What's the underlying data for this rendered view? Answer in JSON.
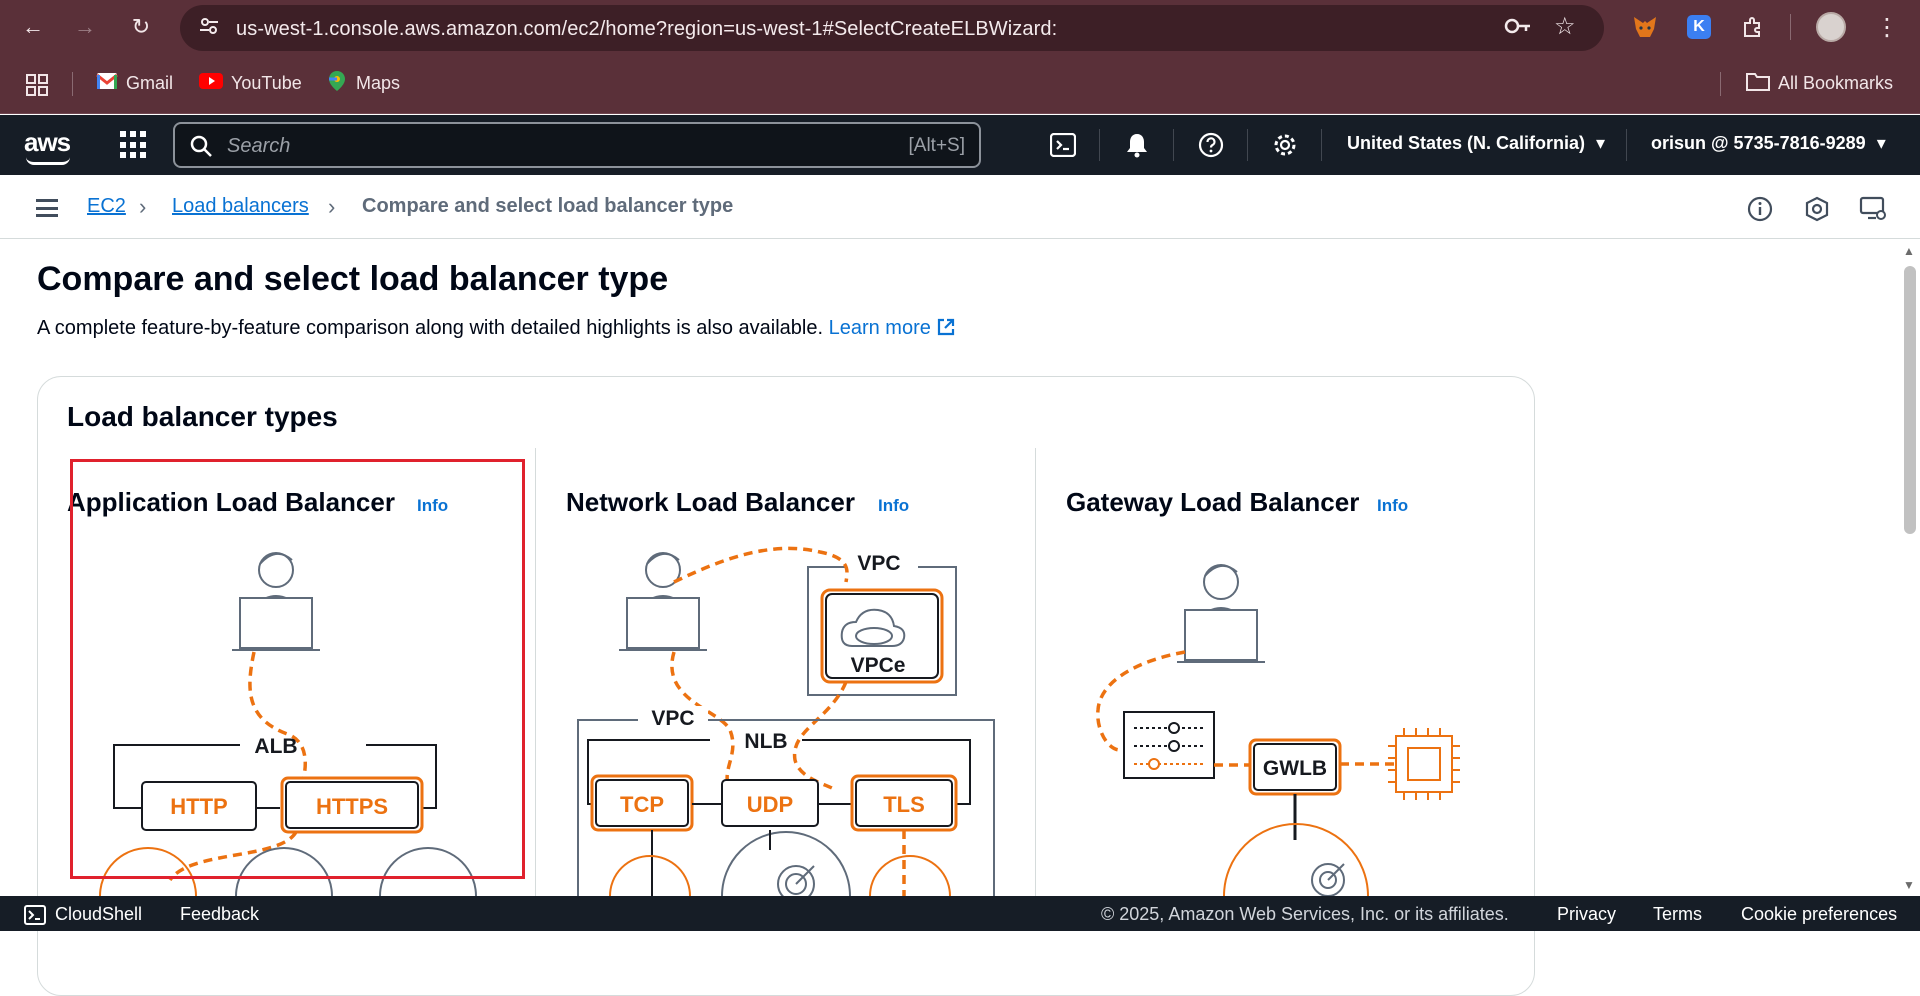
{
  "browser": {
    "url": "us-west-1.console.aws.amazon.com/ec2/home?region=us-west-1#SelectCreateELBWizard:",
    "bookmarks": [
      {
        "label": "Gmail"
      },
      {
        "label": "YouTube"
      },
      {
        "label": "Maps"
      }
    ],
    "all_bookmarks": "All Bookmarks"
  },
  "aws_nav": {
    "logo": "aws",
    "search_placeholder": "Search",
    "search_shortcut": "[Alt+S]",
    "region": "United States (N. California)",
    "account": "orisun @ 5735-7816-9289"
  },
  "breadcrumb": {
    "items": [
      "EC2",
      "Load balancers"
    ],
    "current": "Compare and select load balancer type"
  },
  "page": {
    "title": "Compare and select load balancer type",
    "subtitle": "A complete feature-by-feature comparison along with detailed highlights is also available.",
    "learn_more": "Learn more"
  },
  "card": {
    "title": "Load balancer types",
    "info_label": "Info",
    "types": [
      {
        "name": "Application Load Balancer",
        "info": "Info"
      },
      {
        "name": "Network Load Balancer",
        "info": "Info"
      },
      {
        "name": "Gateway Load Balancer",
        "info": "Info"
      }
    ]
  },
  "diagrams": {
    "alb": {
      "label": "ALB",
      "protocols": [
        "HTTP",
        "HTTPS"
      ]
    },
    "nlb": {
      "vpc_top": "VPC",
      "vpce": "VPCe",
      "vpc": "VPC",
      "label": "NLB",
      "protocols": [
        "TCP",
        "UDP",
        "TLS"
      ]
    },
    "gwlb": {
      "label": "GWLB"
    }
  },
  "footer": {
    "cloudshell": "CloudShell",
    "feedback": "Feedback",
    "copyright": "© 2025, Amazon Web Services, Inc. or its affiliates.",
    "privacy": "Privacy",
    "terms": "Terms",
    "cookies": "Cookie preferences"
  },
  "colors": {
    "chrome": "#5a3039",
    "aws_nav": "#161d26",
    "link": "#0972d3",
    "accent_orange": "#ec7211",
    "highlight_red": "#e0212d"
  }
}
